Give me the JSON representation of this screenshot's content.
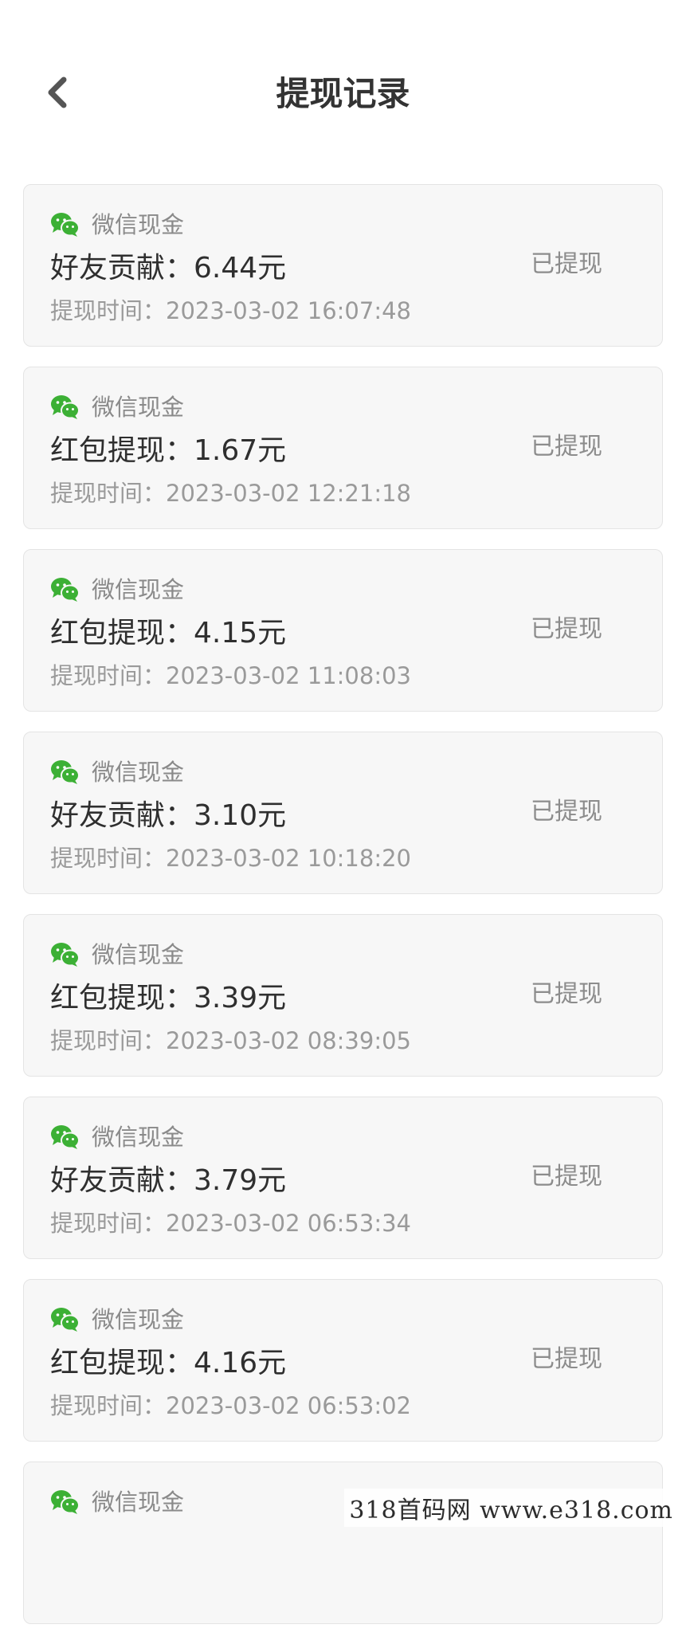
{
  "header": {
    "title": "提现记录",
    "back_icon": "chevron-left-icon"
  },
  "records": [
    {
      "channel": "微信现金",
      "amount": "好友贡献：6.44元",
      "time": "提现时间：2023-03-02 16:07:48",
      "status": "已提现"
    },
    {
      "channel": "微信现金",
      "amount": "红包提现：1.67元",
      "time": "提现时间：2023-03-02 12:21:18",
      "status": "已提现"
    },
    {
      "channel": "微信现金",
      "amount": "红包提现：4.15元",
      "time": "提现时间：2023-03-02 11:08:03",
      "status": "已提现"
    },
    {
      "channel": "微信现金",
      "amount": "好友贡献：3.10元",
      "time": "提现时间：2023-03-02 10:18:20",
      "status": "已提现"
    },
    {
      "channel": "微信现金",
      "amount": "红包提现：3.39元",
      "time": "提现时间：2023-03-02 08:39:05",
      "status": "已提现"
    },
    {
      "channel": "微信现金",
      "amount": "好友贡献：3.79元",
      "time": "提现时间：2023-03-02 06:53:34",
      "status": "已提现"
    },
    {
      "channel": "微信现金",
      "amount": "红包提现：4.16元",
      "time": "提现时间：2023-03-02 06:53:02",
      "status": "已提现"
    },
    {
      "channel": "微信现金",
      "amount": "",
      "time": "",
      "status": ""
    }
  ],
  "watermark": "318首码网  www.e318.com",
  "colors": {
    "wechat_green": "#3cb035",
    "card_bg": "#f7f7f7",
    "card_border": "#e4e4e4",
    "text_primary": "#2f2f2f",
    "text_secondary": "#9a9a9a"
  }
}
